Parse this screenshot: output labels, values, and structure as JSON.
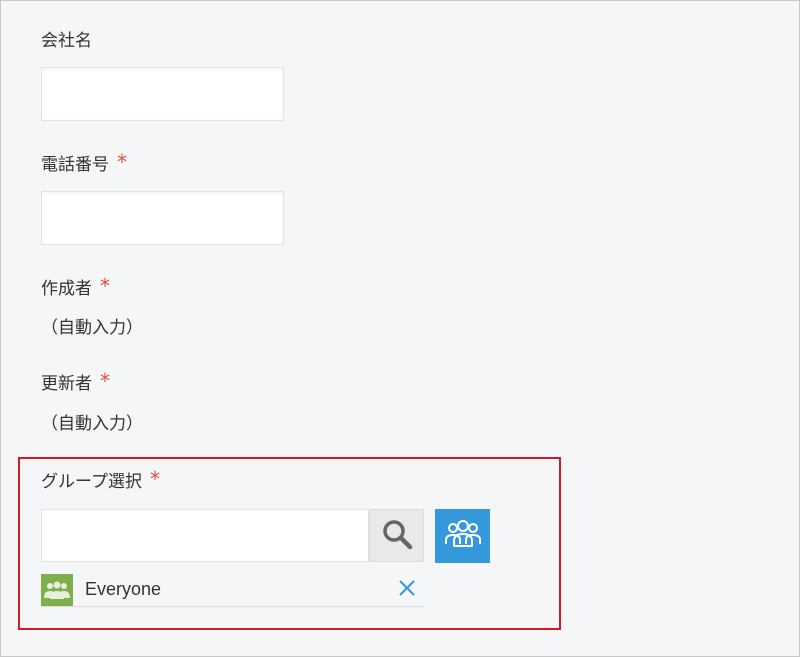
{
  "form": {
    "company": {
      "label": "会社名",
      "value": ""
    },
    "phone": {
      "label": "電話番号",
      "required_mark": "*",
      "value": ""
    },
    "creator": {
      "label": "作成者",
      "required_mark": "*",
      "value": "（自動入力）"
    },
    "updater": {
      "label": "更新者",
      "required_mark": "*",
      "value": "（自動入力）"
    },
    "group": {
      "label": "グループ選択",
      "required_mark": "*",
      "value": "",
      "selected": [
        {
          "name": "Everyone",
          "icon": "group-icon"
        }
      ]
    }
  },
  "icons": {
    "search": "search-icon",
    "group_picker": "group-picker-icon",
    "remove": "close-icon"
  },
  "colors": {
    "required": "#e74c3c",
    "highlight_border": "#d11a2a",
    "group_button": "#3498db",
    "group_entry_icon": "#7fae4c",
    "remove_icon": "#3498db"
  }
}
